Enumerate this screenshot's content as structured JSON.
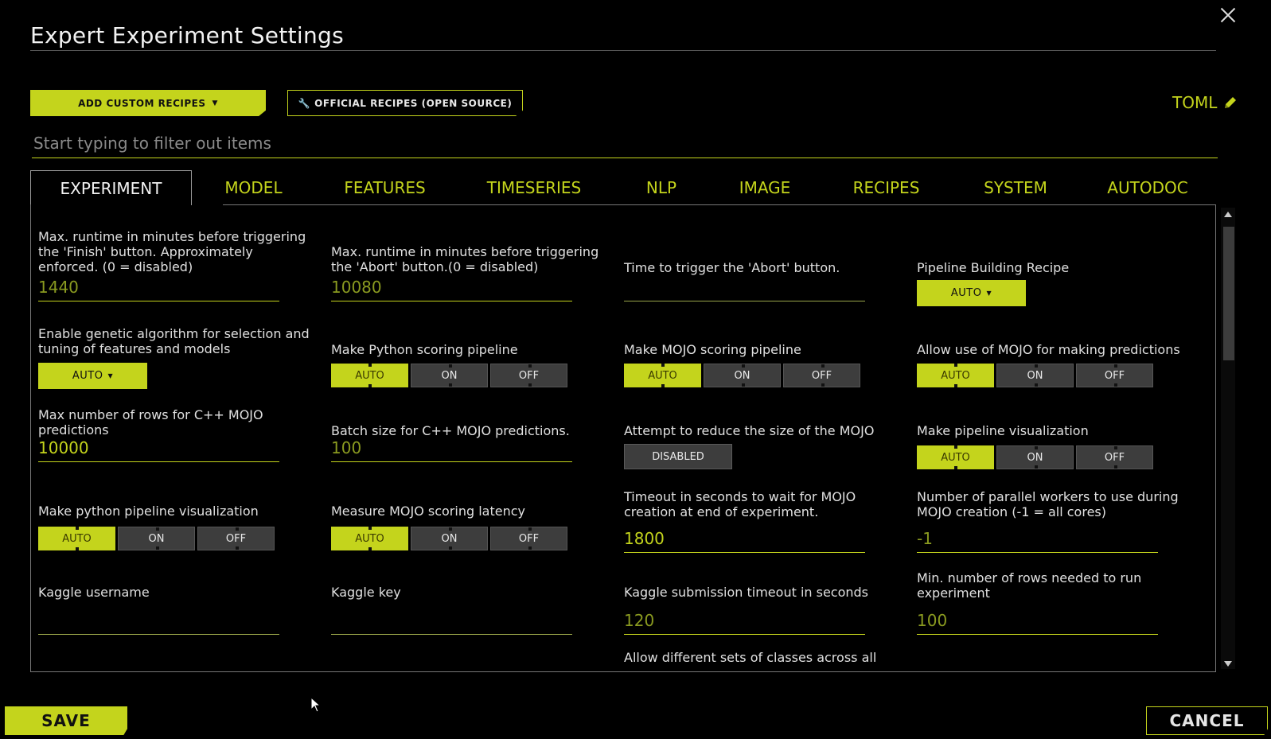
{
  "dialog": {
    "title": "Expert Experiment Settings"
  },
  "toolbar": {
    "add_custom_recipes": "ADD CUSTOM RECIPES",
    "official_recipes": "OFFICIAL RECIPES (OPEN SOURCE)",
    "toml": "TOML"
  },
  "filter": {
    "placeholder": "Start typing to filter out items"
  },
  "tabs": [
    "EXPERIMENT",
    "MODEL",
    "FEATURES",
    "TIMESERIES",
    "NLP",
    "IMAGE",
    "RECIPES",
    "SYSTEM",
    "AUTODOC"
  ],
  "active_tab": "EXPERIMENT",
  "settings": {
    "finish_runtime": {
      "label": "Max. runtime in minutes before triggering the 'Finish' button. Approximately enforced. (0 = disabled)",
      "value": "1440"
    },
    "abort_runtime": {
      "label": "Max. runtime in minutes before triggering the 'Abort' button.(0 = disabled)",
      "value": "10080"
    },
    "abort_time": {
      "label": "Time to trigger the 'Abort' button.",
      "value": ""
    },
    "pipeline_recipe": {
      "label": "Pipeline Building Recipe",
      "value": "AUTO"
    },
    "genetic_algo": {
      "label": "Enable genetic algorithm for selection and tuning of features and models",
      "value": "AUTO"
    },
    "python_scoring": {
      "label": "Make Python scoring pipeline",
      "options": [
        "AUTO",
        "ON",
        "OFF"
      ],
      "selected": "AUTO"
    },
    "mojo_scoring": {
      "label": "Make MOJO scoring pipeline",
      "options": [
        "AUTO",
        "ON",
        "OFF"
      ],
      "selected": "AUTO"
    },
    "mojo_predictions": {
      "label": "Allow use of MOJO for making predictions",
      "options": [
        "AUTO",
        "ON",
        "OFF"
      ],
      "selected": "AUTO"
    },
    "max_rows_mojo": {
      "label": "Max number of rows for C++ MOJO predictions",
      "value": "10000"
    },
    "batch_size_mojo": {
      "label": "Batch size for C++ MOJO predictions.",
      "value": "100"
    },
    "reduce_mojo": {
      "label": "Attempt to reduce the size of the MOJO",
      "value": "DISABLED"
    },
    "pipeline_viz": {
      "label": "Make pipeline visualization",
      "options": [
        "AUTO",
        "ON",
        "OFF"
      ],
      "selected": "AUTO"
    },
    "python_pipeline_viz": {
      "label": "Make python pipeline visualization",
      "options": [
        "AUTO",
        "ON",
        "OFF"
      ],
      "selected": "AUTO"
    },
    "mojo_latency": {
      "label": "Measure MOJO scoring latency",
      "options": [
        "AUTO",
        "ON",
        "OFF"
      ],
      "selected": "AUTO"
    },
    "mojo_timeout": {
      "label": "Timeout in seconds to wait for MOJO creation at end of experiment.",
      "value": "1800"
    },
    "mojo_workers": {
      "label": "Number of parallel workers to use during MOJO creation (-1 = all cores)",
      "value": "-1"
    },
    "kaggle_username": {
      "label": "Kaggle username",
      "value": ""
    },
    "kaggle_key": {
      "label": "Kaggle key",
      "value": ""
    },
    "kaggle_timeout": {
      "label": "Kaggle submission timeout in seconds",
      "value": "120"
    },
    "min_rows": {
      "label": "Min. number of rows needed to run experiment",
      "value": "100"
    },
    "diff_classes": {
      "label": "Allow different sets of classes across all"
    }
  },
  "footer": {
    "save": "SAVE",
    "cancel": "CANCEL"
  },
  "colors": {
    "accent": "#c4d41c",
    "background": "#000000",
    "toggle_off": "#3d3d3d"
  }
}
